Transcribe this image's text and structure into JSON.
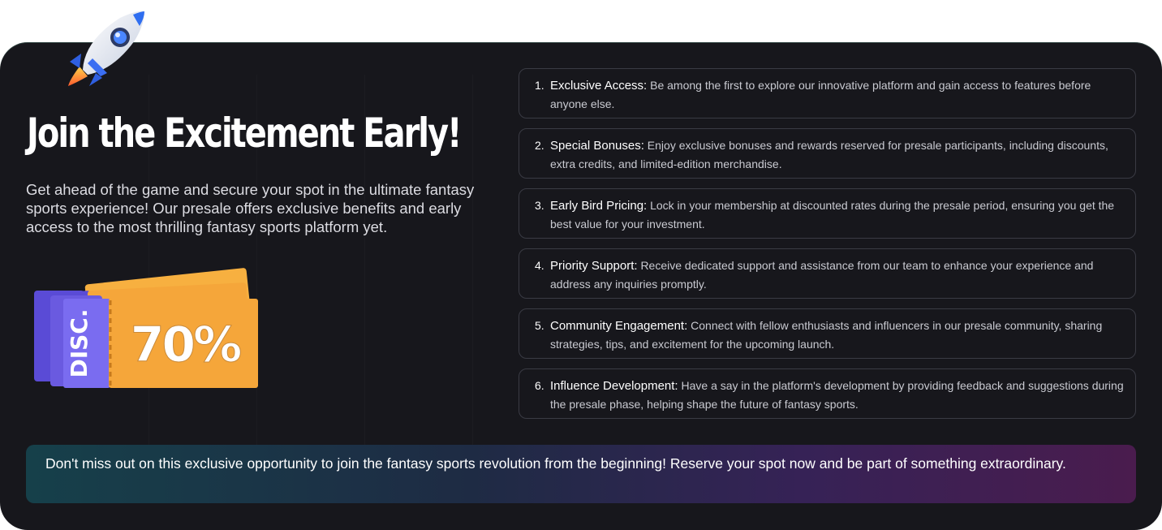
{
  "hero": {
    "title": "Join the Excitement Early!",
    "description": "Get ahead of the game and secure your spot in the ultimate fantasy sports experience! Our presale offers exclusive benefits and early access to the most thrilling fantasy sports platform yet.",
    "ticket": {
      "label": "DISC.",
      "value": "70%"
    }
  },
  "benefits": [
    {
      "number": "1.",
      "title": "Exclusive Access:",
      "text": "Be among the first to explore our innovative platform and gain access to features before anyone else."
    },
    {
      "number": "2.",
      "title": "Special Bonuses:",
      "text": "Enjoy exclusive bonuses and rewards reserved for presale participants, including discounts, extra credits, and limited-edition merchandise."
    },
    {
      "number": "3.",
      "title": "Early Bird Pricing:",
      "text": "Lock in your membership at discounted rates during the presale period, ensuring you get the best value for your investment."
    },
    {
      "number": "4.",
      "title": "Priority Support:",
      "text": "Receive dedicated support and assistance from our team to enhance your experience and address any inquiries promptly."
    },
    {
      "number": "5.",
      "title": "Community Engagement:",
      "text": "Connect with fellow enthusiasts and influencers in our presale community, sharing strategies, tips, and excitement for the upcoming launch."
    },
    {
      "number": "6.",
      "title": "Influence Development:",
      "text": "Have a say in the platform's development by providing feedback and suggestions during the presale phase, helping shape the future of fantasy sports."
    }
  ],
  "banner": {
    "text": "Don't miss out on this exclusive opportunity to join the fantasy sports revolution from the beginning! Reserve your spot now and be part of something extraordinary."
  },
  "colors": {
    "card_background": "#17171c",
    "ticket_orange": "#f5a63a",
    "ticket_purple": "#6a5ae0",
    "banner_start": "#16404a",
    "banner_end": "#4a1c4e"
  },
  "icons": {
    "rocket": "rocket-icon"
  }
}
